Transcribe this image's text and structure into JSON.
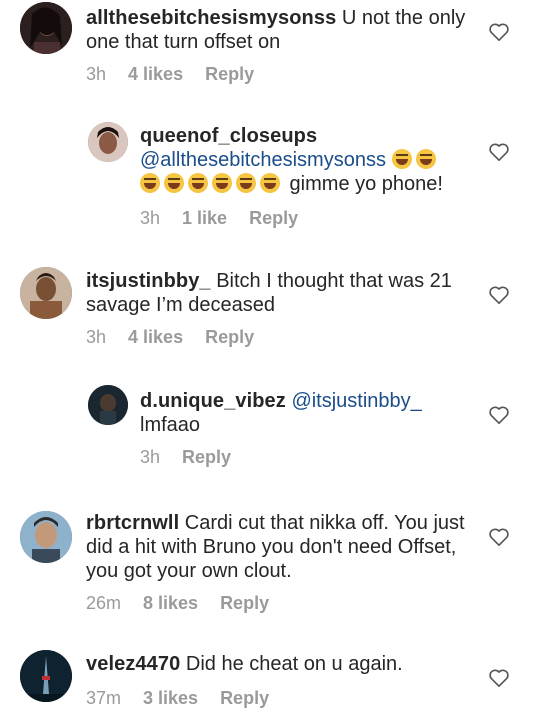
{
  "comments": [
    {
      "username": "allthesebitchesismysonss",
      "text": " U not the only one that turn offset on",
      "time": "3h",
      "likes": "4 likes",
      "reply": "Reply",
      "avatar_color": "#3a2a2a"
    },
    {
      "username": "queenof_closeups",
      "mention": "@allthesebitchesismysonss",
      "text": " gimme yo phone!",
      "emoji": "grinning-squinting-face-emoji",
      "time": "3h",
      "likes": "1 like",
      "reply": "Reply",
      "avatar_color": "#8a5a4a"
    },
    {
      "username": "itsjustinbby_",
      "text": " Bitch I thought that was 21 savage I’m deceased",
      "time": "3h",
      "likes": "4 likes",
      "reply": "Reply",
      "avatar_color": "#6a4a3a"
    },
    {
      "username": "d.unique_vibez",
      "mention": "@itsjustinbby_",
      "text": "lmfaao",
      "time": "3h",
      "reply": "Reply",
      "avatar_color": "#1e2a33"
    },
    {
      "username": "rbrtcrnwll",
      "text": " Cardi cut that nikka off. You just did a hit with Bruno you don't need Offset, you got your own clout.",
      "time": "26m",
      "likes": "8 likes",
      "reply": "Reply",
      "avatar_color": "#4a6a8a"
    },
    {
      "username": "velez4470",
      "text": " Did he cheat on u again.",
      "time": "37m",
      "likes": "3 likes",
      "reply": "Reply",
      "avatar_color": "#1a3040"
    }
  ],
  "colors": {
    "text": "#262626",
    "meta": "#9a9a9a",
    "mention": "#1a4e8a",
    "heart_outline": "#555555"
  },
  "icons": {
    "like": "heart-outline-icon"
  }
}
